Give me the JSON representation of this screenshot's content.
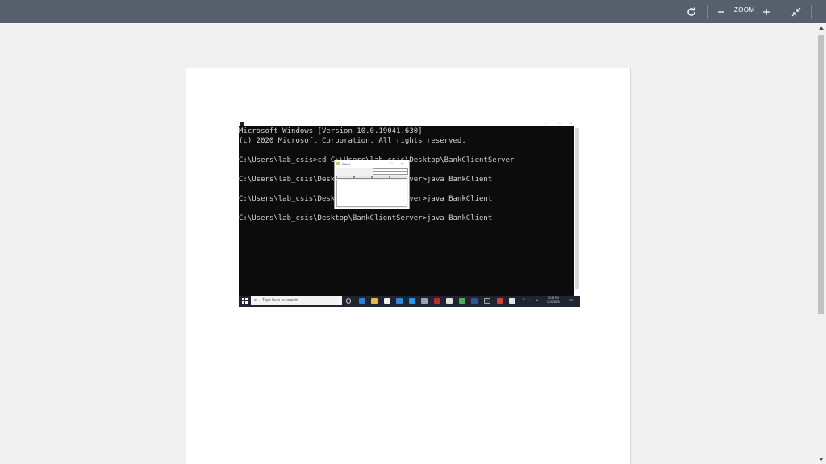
{
  "toolbar": {
    "zoom_label": "ZOOM",
    "icons": {
      "rotate": "rotate-icon",
      "zoom_out": "minus-icon",
      "zoom_in": "plus-icon",
      "exit_fullscreen": "collapse-icon"
    }
  },
  "screenshot": {
    "console_lines": [
      "Microsoft Windows [Version 10.0.19041.630]",
      "(c) 2020 Microsoft Corporation. All rights reserved.",
      "",
      "C:\\Users\\lab_csis>cd C:\\Users\\lab_csis\\Desktop\\BankClientServer",
      "",
      "C:\\Users\\lab_csis\\Desktop\\BankClientServer>java BankClient",
      "",
      "C:\\Users\\lab_csis\\Desktop\\BankClientServer>java BankClient",
      "",
      "C:\\Users\\lab_csis\\Desktop\\BankClientServer>java BankClient"
    ],
    "client_window": {
      "title": "Client"
    },
    "taskbar": {
      "search_placeholder": "Type here to search",
      "time": "12:23 PM",
      "date": "11/22/2020"
    }
  },
  "colors": {
    "toolbar_bg": "#56606c",
    "console_bg": "#0c0c0c",
    "console_text": "#d4d4d4",
    "taskbar_bg": "#1f2430"
  }
}
